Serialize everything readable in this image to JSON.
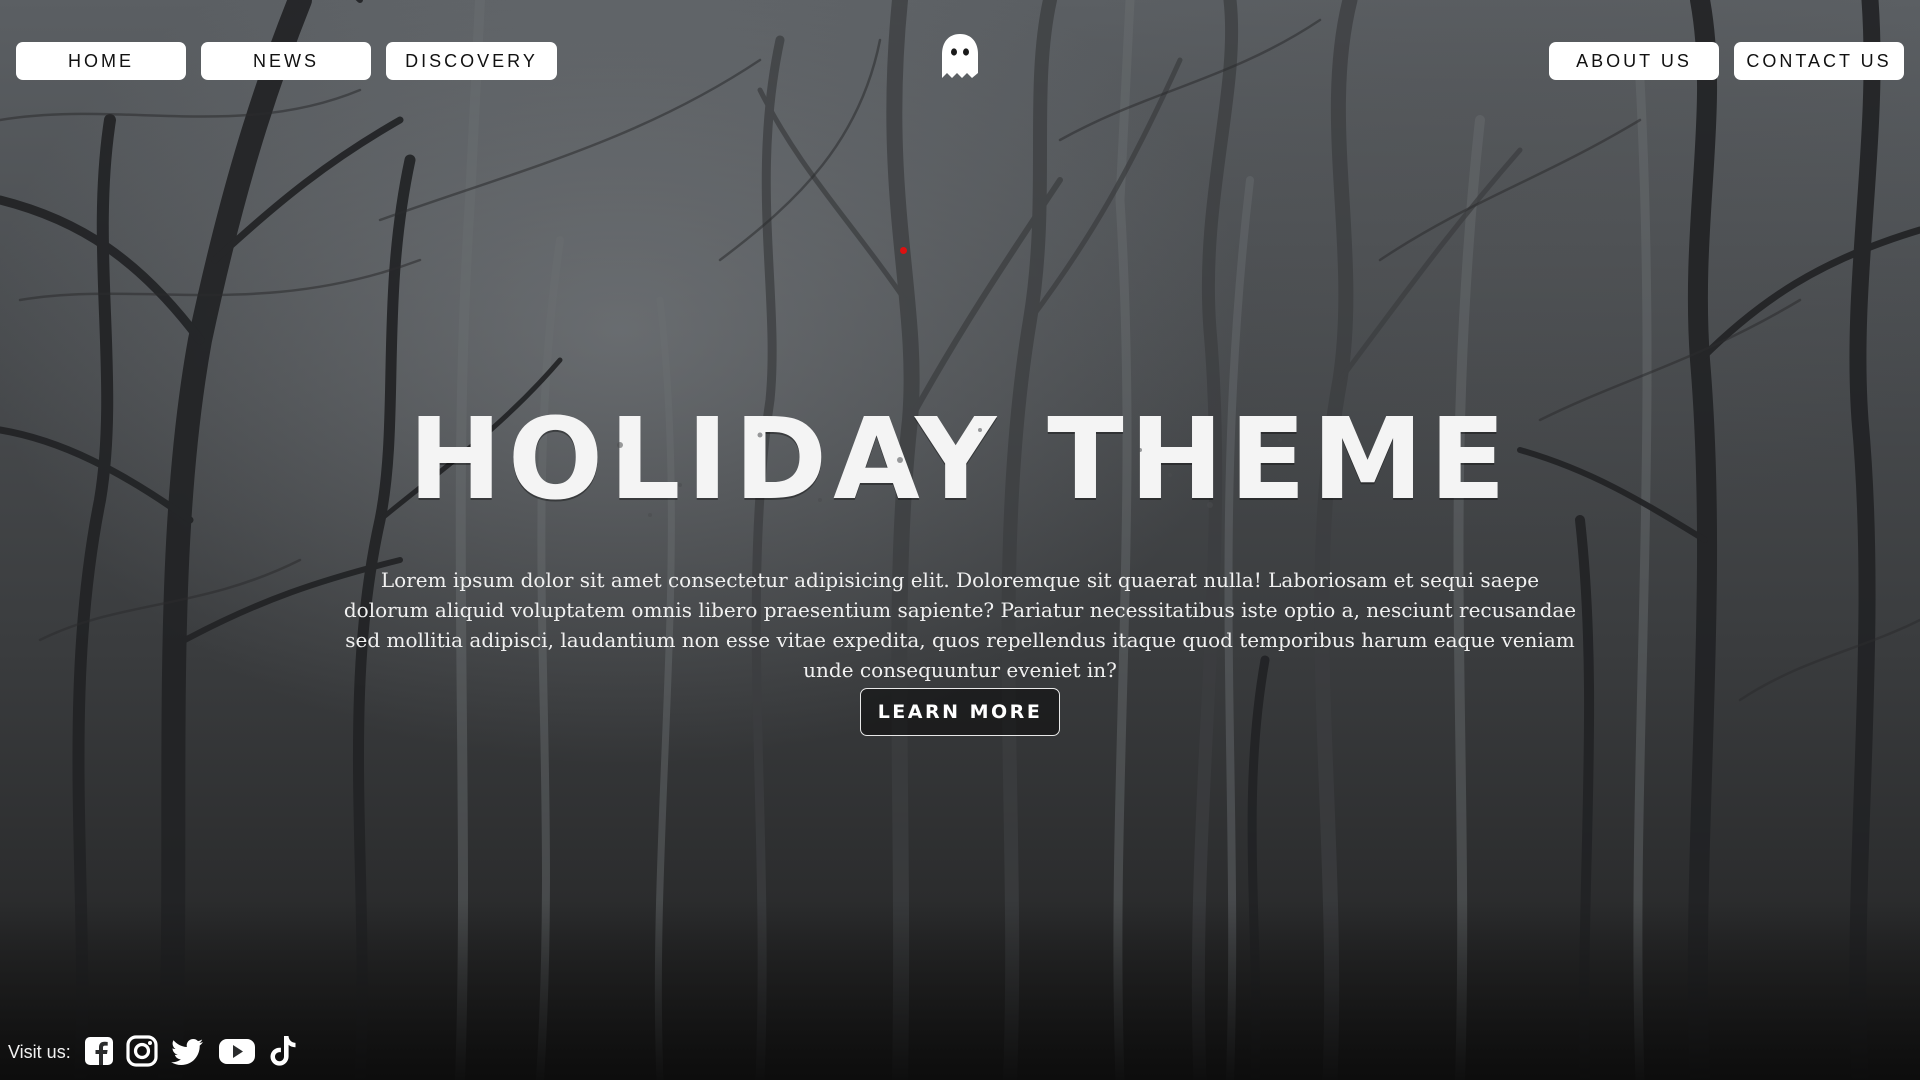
{
  "nav": {
    "left": [
      {
        "label": "HOME"
      },
      {
        "label": "NEWS"
      },
      {
        "label": "DISCOVERY"
      }
    ],
    "right": [
      {
        "label": "ABOUT US"
      },
      {
        "label": "CONTACT US"
      }
    ]
  },
  "logo": {
    "icon": "ghost-icon"
  },
  "hero": {
    "title": "HOLIDAY THEME",
    "text": "Lorem ipsum dolor sit amet consectetur adipisicing elit. Doloremque sit quaerat nulla! Laboriosam et sequi saepe dolorum aliquid voluptatem omnis libero praesentium sapiente? Pariatur necessitatibus iste optio a, nesciunt recusandae sed mollitia adipisci, laudantium non esse vitae expedita, quos repellendus itaque quod temporibus harum eaque veniam unde consequuntur eveniet in?",
    "button_label": "LEARN MORE"
  },
  "footer": {
    "visit_label": "Visit us:",
    "social": [
      "facebook-icon",
      "instagram-icon",
      "twitter-icon",
      "youtube-icon",
      "tiktok-icon"
    ]
  },
  "colors": {
    "accent_dot": "#dd1111",
    "nav_bg": "#ffffff",
    "text": "#f0f0f0"
  }
}
